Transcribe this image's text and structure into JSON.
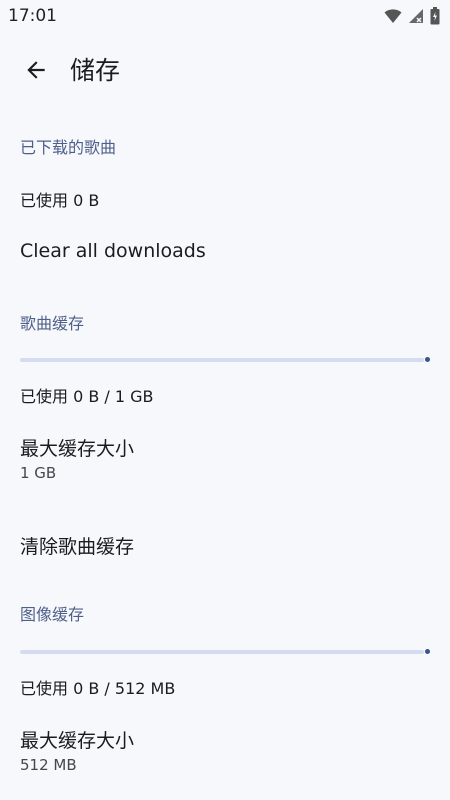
{
  "status_bar": {
    "time": "17:01",
    "icons": [
      "wifi-icon",
      "signal-icon",
      "battery-icon"
    ]
  },
  "app_bar": {
    "back_icon": "arrow-back-icon",
    "title": "储存"
  },
  "downloads": {
    "header": "已下载的歌曲",
    "usage": "已使用 0 B",
    "clear_label": "Clear all downloads"
  },
  "song_cache": {
    "header": "歌曲缓存",
    "progress_fraction": 0,
    "usage": "已使用 0 B / 1 GB",
    "max_size_label": "最大缓存大小",
    "max_size_value": "1 GB",
    "clear_label": "清除歌曲缓存"
  },
  "image_cache": {
    "header": "图像缓存",
    "progress_fraction": 0,
    "usage": "已使用 0 B / 512 MB",
    "max_size_label": "最大缓存大小",
    "max_size_value": "512 MB"
  },
  "colors": {
    "background": "#f7f8fc",
    "section_header": "#4e5f8a",
    "progress_track": "#d6dcef",
    "progress_indicator": "#3b5290"
  }
}
